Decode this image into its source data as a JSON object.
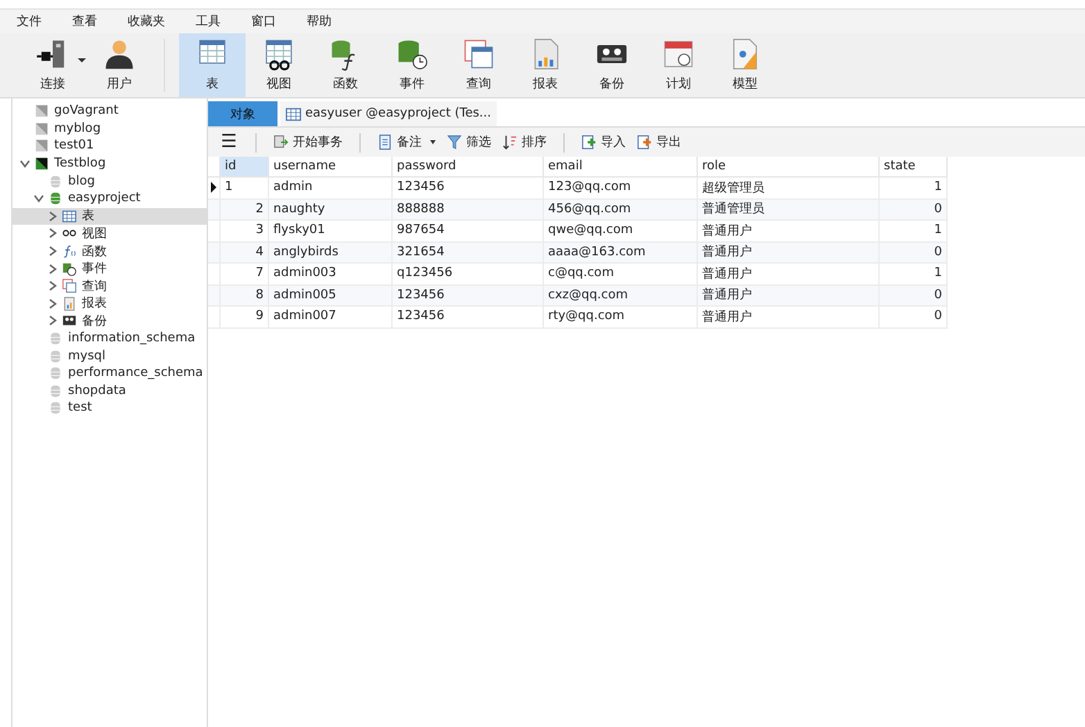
{
  "menu": [
    "文件",
    "查看",
    "收藏夹",
    "工具",
    "窗口",
    "帮助"
  ],
  "toolbar": [
    {
      "kind": "connect",
      "label": "连接",
      "selected": false,
      "dropdown": true
    },
    {
      "kind": "user",
      "label": "用户",
      "selected": false,
      "dropdown": false
    },
    {
      "kind": "table",
      "label": "表",
      "selected": true,
      "dropdown": false
    },
    {
      "kind": "view",
      "label": "视图",
      "selected": false,
      "dropdown": false
    },
    {
      "kind": "function",
      "label": "函数",
      "selected": false,
      "dropdown": false
    },
    {
      "kind": "event",
      "label": "事件",
      "selected": false,
      "dropdown": false
    },
    {
      "kind": "query",
      "label": "查询",
      "selected": false,
      "dropdown": false
    },
    {
      "kind": "report",
      "label": "报表",
      "selected": false,
      "dropdown": false
    },
    {
      "kind": "backup",
      "label": "备份",
      "selected": false,
      "dropdown": false
    },
    {
      "kind": "schedule",
      "label": "计划",
      "selected": false,
      "dropdown": false
    },
    {
      "kind": "model",
      "label": "模型",
      "selected": false,
      "dropdown": false
    }
  ],
  "sidebar": {
    "items": [
      {
        "kind": "connection",
        "label": "goVagrant",
        "expanded": false
      },
      {
        "kind": "connection",
        "label": "myblog",
        "expanded": false
      },
      {
        "kind": "connection",
        "label": "test01",
        "expanded": false
      },
      {
        "kind": "connection",
        "label": "Testblog",
        "expanded": true,
        "children": [
          {
            "kind": "database",
            "label": "blog",
            "expanded": false
          },
          {
            "kind": "database",
            "label": "easyproject",
            "expanded": true,
            "children": [
              {
                "kind": "table",
                "label": "表",
                "expanded": false,
                "selected": true
              },
              {
                "kind": "view",
                "label": "视图",
                "expanded": false,
                "selected": false
              },
              {
                "kind": "function",
                "label": "函数",
                "expanded": false,
                "selected": false
              },
              {
                "kind": "event",
                "label": "事件",
                "expanded": false,
                "selected": false
              },
              {
                "kind": "query",
                "label": "查询",
                "expanded": false,
                "selected": false
              },
              {
                "kind": "report",
                "label": "报表",
                "expanded": false,
                "selected": false
              },
              {
                "kind": "backup",
                "label": "备份",
                "expanded": false,
                "selected": false
              }
            ]
          },
          {
            "kind": "database",
            "label": "information_schema",
            "expanded": false
          },
          {
            "kind": "database",
            "label": "mysql",
            "expanded": false
          },
          {
            "kind": "database",
            "label": "performance_schema",
            "expanded": false
          },
          {
            "kind": "database",
            "label": "shopdata",
            "expanded": false
          },
          {
            "kind": "database",
            "label": "test",
            "expanded": false
          }
        ]
      }
    ]
  },
  "tabs": [
    {
      "kind": "objects",
      "label": "对象",
      "selected": true
    },
    {
      "kind": "table",
      "label": "easyuser @easyproject (Tes...",
      "selected": false
    }
  ],
  "grid_toolbar": [
    {
      "kind": "menu",
      "label": "☰"
    },
    {
      "kind": "transaction",
      "label": "开始事务"
    },
    {
      "kind": "note",
      "label": "备注",
      "dropdown": true
    },
    {
      "kind": "filter",
      "label": "筛选"
    },
    {
      "kind": "sort",
      "label": "排序"
    },
    {
      "kind": "import",
      "label": "导入"
    },
    {
      "kind": "export",
      "label": "导出"
    }
  ],
  "table": {
    "columns": [
      "id",
      "username",
      "password",
      "email",
      "role",
      "state"
    ],
    "rows": [
      {
        "current": true,
        "cells": [
          "1",
          "admin",
          "123456",
          "123@qq.com",
          "超级管理员",
          "1"
        ]
      },
      {
        "current": false,
        "cells": [
          "2",
          "naughty",
          "888888",
          "456@qq.com",
          "普通管理员",
          "0"
        ]
      },
      {
        "current": false,
        "cells": [
          "3",
          "flysky01",
          "987654",
          "qwe@qq.com",
          "普通用户",
          "1"
        ]
      },
      {
        "current": false,
        "cells": [
          "4",
          "anglybirds",
          "321654",
          "aaaa@163.com",
          "普通用户",
          "0"
        ]
      },
      {
        "current": false,
        "cells": [
          "7",
          "admin003",
          "q123456",
          "c@qq.com",
          "普通用户",
          "1"
        ]
      },
      {
        "current": false,
        "cells": [
          "8",
          "admin005",
          "123456",
          "cxz@qq.com",
          "普通用户",
          "0"
        ]
      },
      {
        "current": false,
        "cells": [
          "9",
          "admin007",
          "123456",
          "rty@qq.com",
          "普通用户",
          "0"
        ]
      }
    ]
  }
}
